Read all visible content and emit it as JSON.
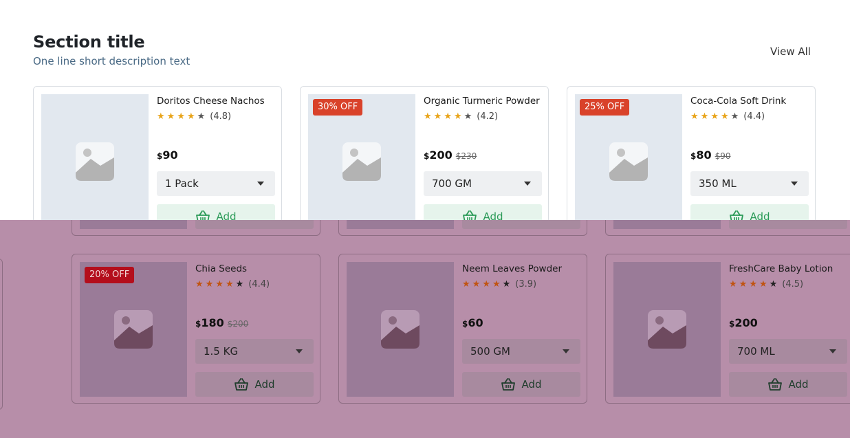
{
  "section": {
    "title": "Section title",
    "description": "One line short description text",
    "view_all": "View All"
  },
  "products_row1": [
    {
      "badge": "",
      "name": "Doritos Cheese Nachos",
      "rating": "(4.8)",
      "stars": 4,
      "currency": "$",
      "price": "90",
      "mrp": "",
      "variant": "1 Pack",
      "add_label": "Add"
    },
    {
      "badge": "30% OFF",
      "name": "Organic Turmeric Powder",
      "rating": "(4.2)",
      "stars": 4,
      "currency": "$",
      "price": "200",
      "mrp": "$230",
      "variant": "700 GM",
      "add_label": "Add"
    },
    {
      "badge": "25% OFF",
      "name": "Coca-Cola Soft Drink",
      "rating": "(4.4)",
      "stars": 4,
      "currency": "$",
      "price": "80",
      "mrp": "$90",
      "variant": "350 ML",
      "add_label": "Add"
    }
  ],
  "products_row2": [
    {
      "badge": "20% OFF",
      "name": "Chia Seeds",
      "rating": "(4.4)",
      "stars": 4,
      "currency": "$",
      "price": "180",
      "mrp": "$200",
      "variant": "1.5 KG",
      "add_label": "Add"
    },
    {
      "badge": "",
      "name": "Neem Leaves Powder",
      "rating": "(3.9)",
      "stars": 4,
      "currency": "$",
      "price": "60",
      "mrp": "",
      "variant": "500 GM",
      "add_label": "Add"
    },
    {
      "badge": "",
      "name": "FreshCare Baby Lotion",
      "rating": "(4.5)",
      "stars": 4,
      "currency": "$",
      "price": "200",
      "mrp": "",
      "variant": "700 ML",
      "add_label": "Add"
    }
  ],
  "icons": {
    "image_placeholder": "image-placeholder-icon",
    "basket": "basket-icon",
    "star": "star-icon",
    "caret": "chevron-down-icon"
  },
  "colors": {
    "badge": "#d9422a",
    "star": "#e8a317",
    "add_bg": "#e6f4ec",
    "add_text": "#2a9a57",
    "overlay": "#b78ea9"
  }
}
